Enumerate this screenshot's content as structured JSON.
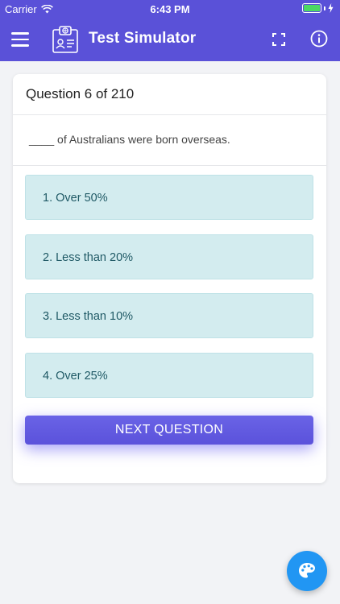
{
  "status_bar": {
    "carrier": "Carrier",
    "time": "6:43 PM",
    "battery_level": 1.0
  },
  "header": {
    "title": "Test Simulator",
    "menu_icon": "hamburger-menu-icon",
    "logo_icon": "citizenship-id-card-icon",
    "fullscreen_icon": "fullscreen-icon",
    "info_icon": "info-icon"
  },
  "question": {
    "heading": "Question 6 of 210",
    "text": "____ of Australians were born overseas."
  },
  "options": [
    {
      "label": "1. Over 50%"
    },
    {
      "label": "2. Less than 20%"
    },
    {
      "label": "3. Less than 10%"
    },
    {
      "label": "4. Over 25%"
    }
  ],
  "next_button": {
    "label": "NEXT QUESTION"
  },
  "fab": {
    "icon": "palette-icon"
  },
  "colors": {
    "primary": "#5a51d8",
    "option_bg": "#d3ecef",
    "option_text": "#1f5965",
    "fab": "#2196f3"
  }
}
